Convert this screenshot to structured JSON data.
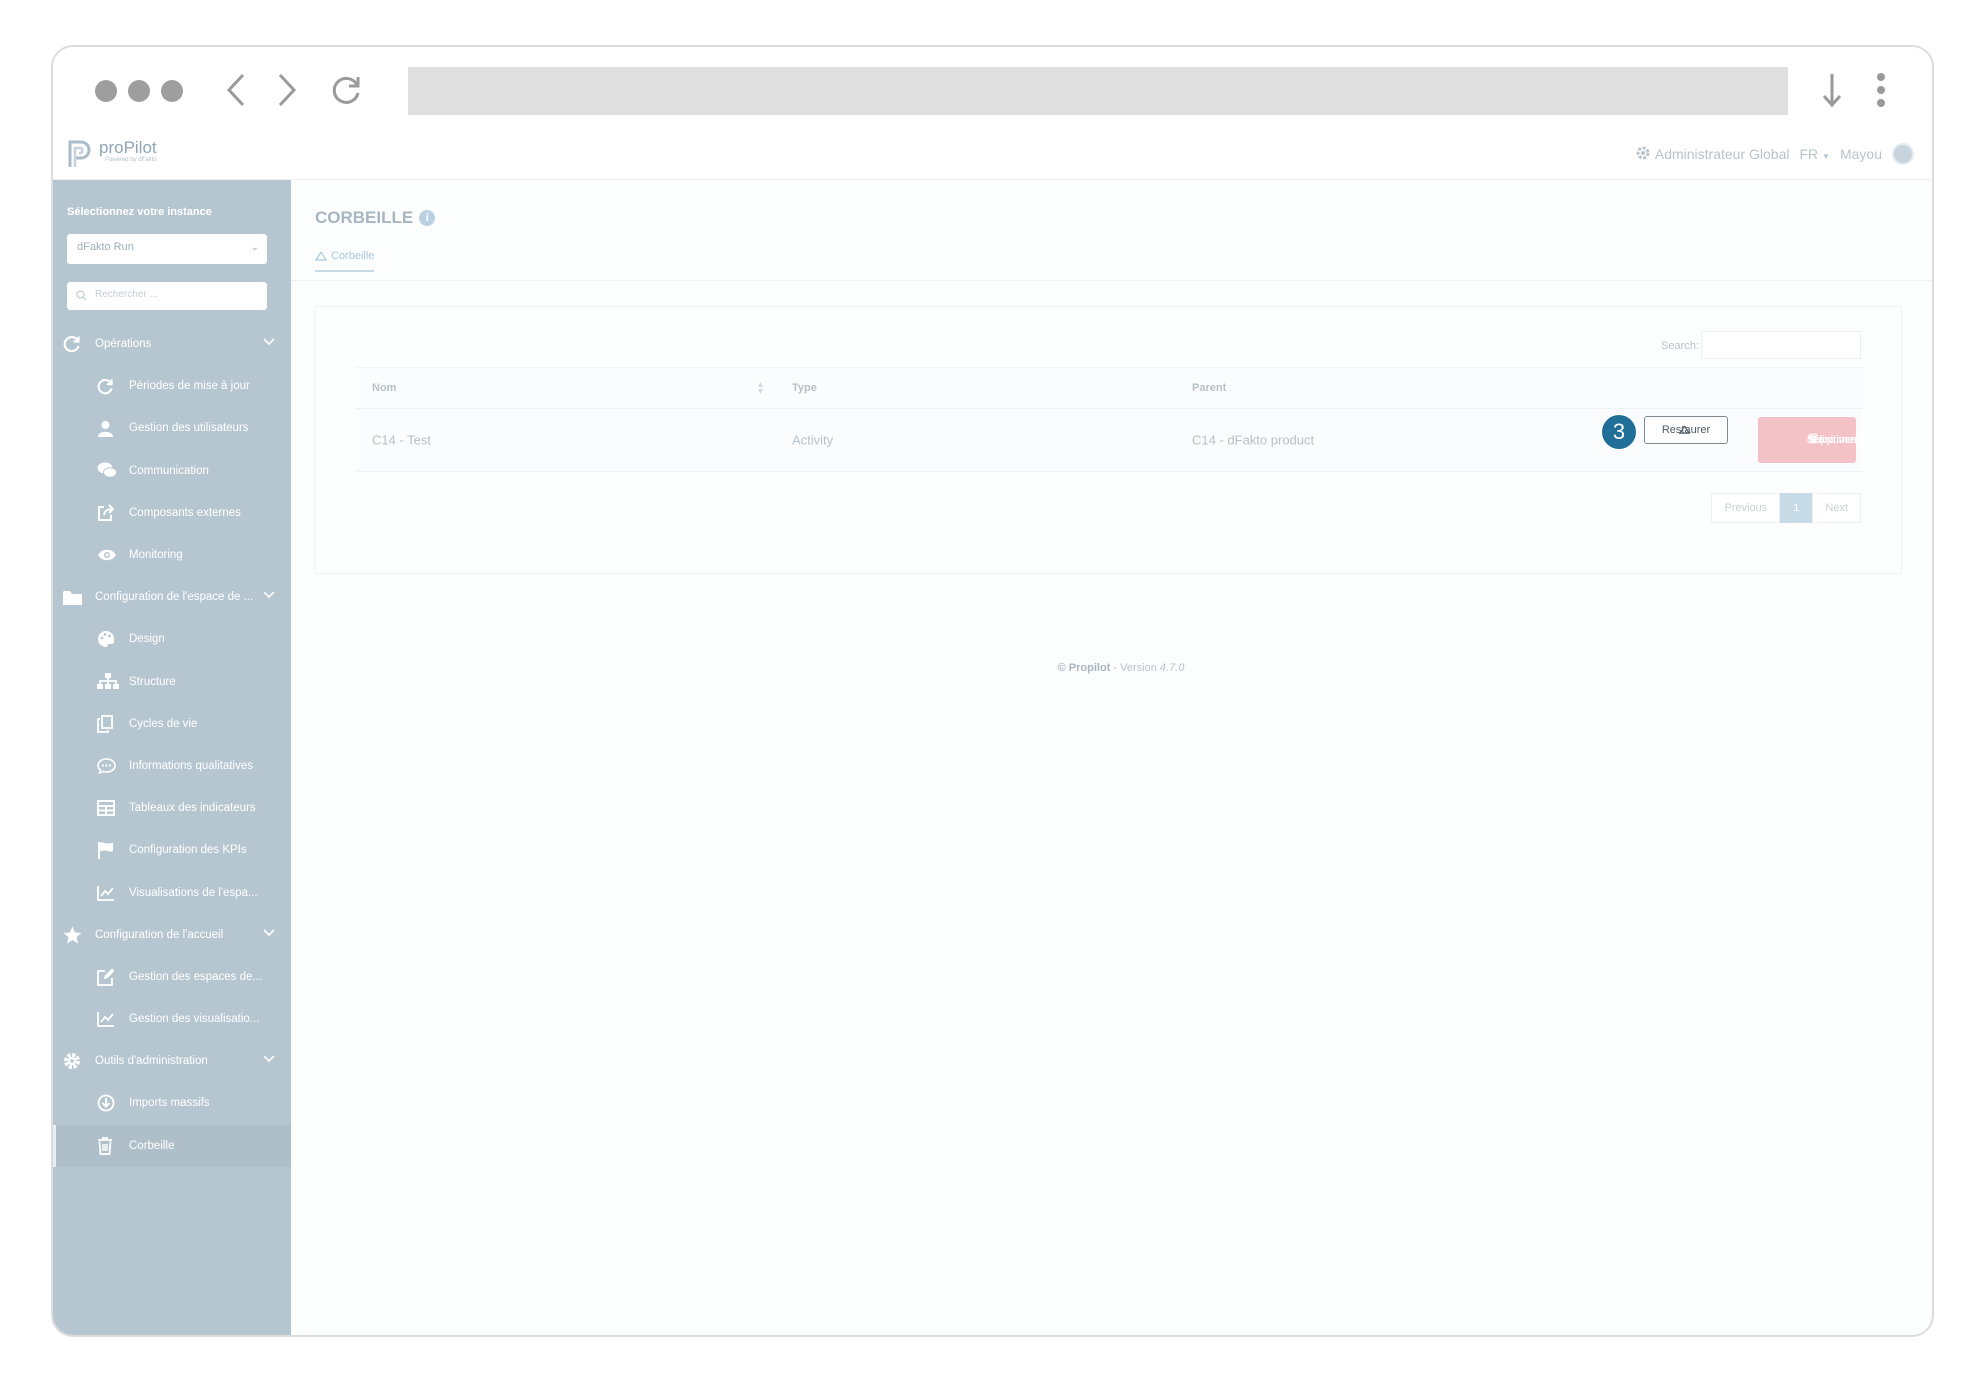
{
  "header": {
    "logo_name": "proPilot",
    "logo_sub": "Powered by dFakto",
    "role": "Administrateur Global",
    "lang": "FR",
    "user": "Mayou"
  },
  "sidebar": {
    "instance_label": "Sélectionnez votre instance",
    "instance_value": "dFakto Run",
    "search_placeholder": "Rechercher ...",
    "items": [
      {
        "label": "Opérations",
        "icon": "refresh-icon",
        "section": true
      },
      {
        "label": "Périodes de mise à jour",
        "icon": "refresh-icon"
      },
      {
        "label": "Gestion des utilisateurs",
        "icon": "user-icon"
      },
      {
        "label": "Communication",
        "icon": "chat-icon"
      },
      {
        "label": "Composants externes",
        "icon": "external-share-icon"
      },
      {
        "label": "Monitoring",
        "icon": "eye-icon"
      },
      {
        "label": "Configuration de l'espace de ...",
        "icon": "folder-icon",
        "section": true
      },
      {
        "label": "Design",
        "icon": "palette-icon"
      },
      {
        "label": "Structure",
        "icon": "sitemap-icon"
      },
      {
        "label": "Cycles de vie",
        "icon": "copy-icon"
      },
      {
        "label": "Informations qualitatives",
        "icon": "comment-dots-icon"
      },
      {
        "label": "Tableaux des indicateurs",
        "icon": "table-icon"
      },
      {
        "label": "Configuration des KPIs",
        "icon": "flag-icon"
      },
      {
        "label": "Visualisations de l'espa...",
        "icon": "line-chart-icon"
      },
      {
        "label": "Configuration de l'accueil",
        "icon": "star-icon",
        "section": true
      },
      {
        "label": "Gestion des espaces de...",
        "icon": "edit-icon"
      },
      {
        "label": "Gestion des visualisatio...",
        "icon": "line-chart-icon"
      },
      {
        "label": "Outils d'administration",
        "icon": "gear-icon",
        "section": true
      },
      {
        "label": "Imports massifs",
        "icon": "download-circle-icon"
      },
      {
        "label": "Corbeille",
        "icon": "trash-icon",
        "active": true
      }
    ]
  },
  "main": {
    "title": "CORBEILLE",
    "tab_label": "Corbeille",
    "search_label": "Search:",
    "columns": [
      "Nom",
      "Type",
      "Parent"
    ],
    "rows": [
      {
        "nom": "C14 - Test",
        "type": "Activity",
        "parent": "C14 - dFakto product"
      }
    ],
    "step_number": "3",
    "restore_label": "Restaurer",
    "delete_label_1": "Supprimer",
    "delete_label_2": "définitivement",
    "pager": {
      "previous": "Previous",
      "current": "1",
      "next": "Next"
    }
  },
  "footer": {
    "copyright": "© Propilot",
    "separator": " - Version ",
    "version": "4.7.0"
  },
  "colors": {
    "sidebar": "#b6c6d1",
    "badge": "#1f6f98",
    "danger": "#f2c2c7",
    "accent": "#c6dbe6"
  }
}
